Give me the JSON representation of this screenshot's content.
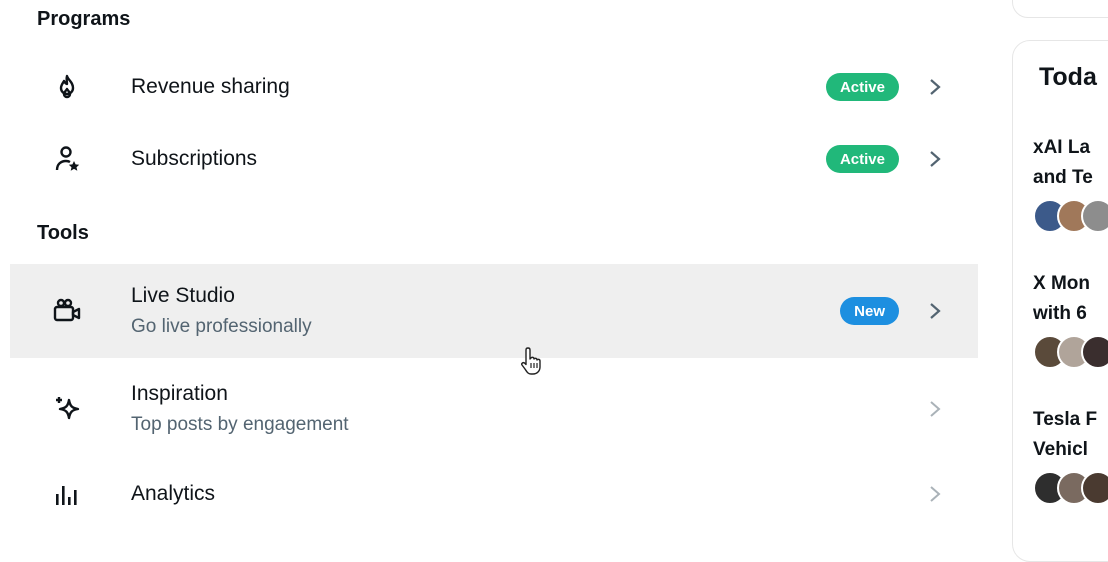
{
  "programs": {
    "title": "Programs",
    "items": [
      {
        "label": "Revenue sharing",
        "badge": "Active",
        "icon": "flame-icon"
      },
      {
        "label": "Subscriptions",
        "badge": "Active",
        "icon": "person-star-icon"
      }
    ]
  },
  "tools": {
    "title": "Tools",
    "items": [
      {
        "label": "Live Studio",
        "sub": "Go live professionally",
        "badge": "New",
        "icon": "video-camera-icon"
      },
      {
        "label": "Inspiration",
        "sub": "Top posts by engagement",
        "icon": "sparkle-icon"
      },
      {
        "label": "Analytics",
        "icon": "bar-chart-icon"
      }
    ]
  },
  "sidebar": {
    "header": "Toda",
    "stories": [
      {
        "title": "xAI La\nand Te"
      },
      {
        "title": "X Mon\nwith 6"
      },
      {
        "title": "Tesla F\nVehicl"
      }
    ]
  },
  "colors": {
    "active": "#21b87a",
    "new": "#1d8fe0",
    "hover_bg": "#efefef"
  }
}
